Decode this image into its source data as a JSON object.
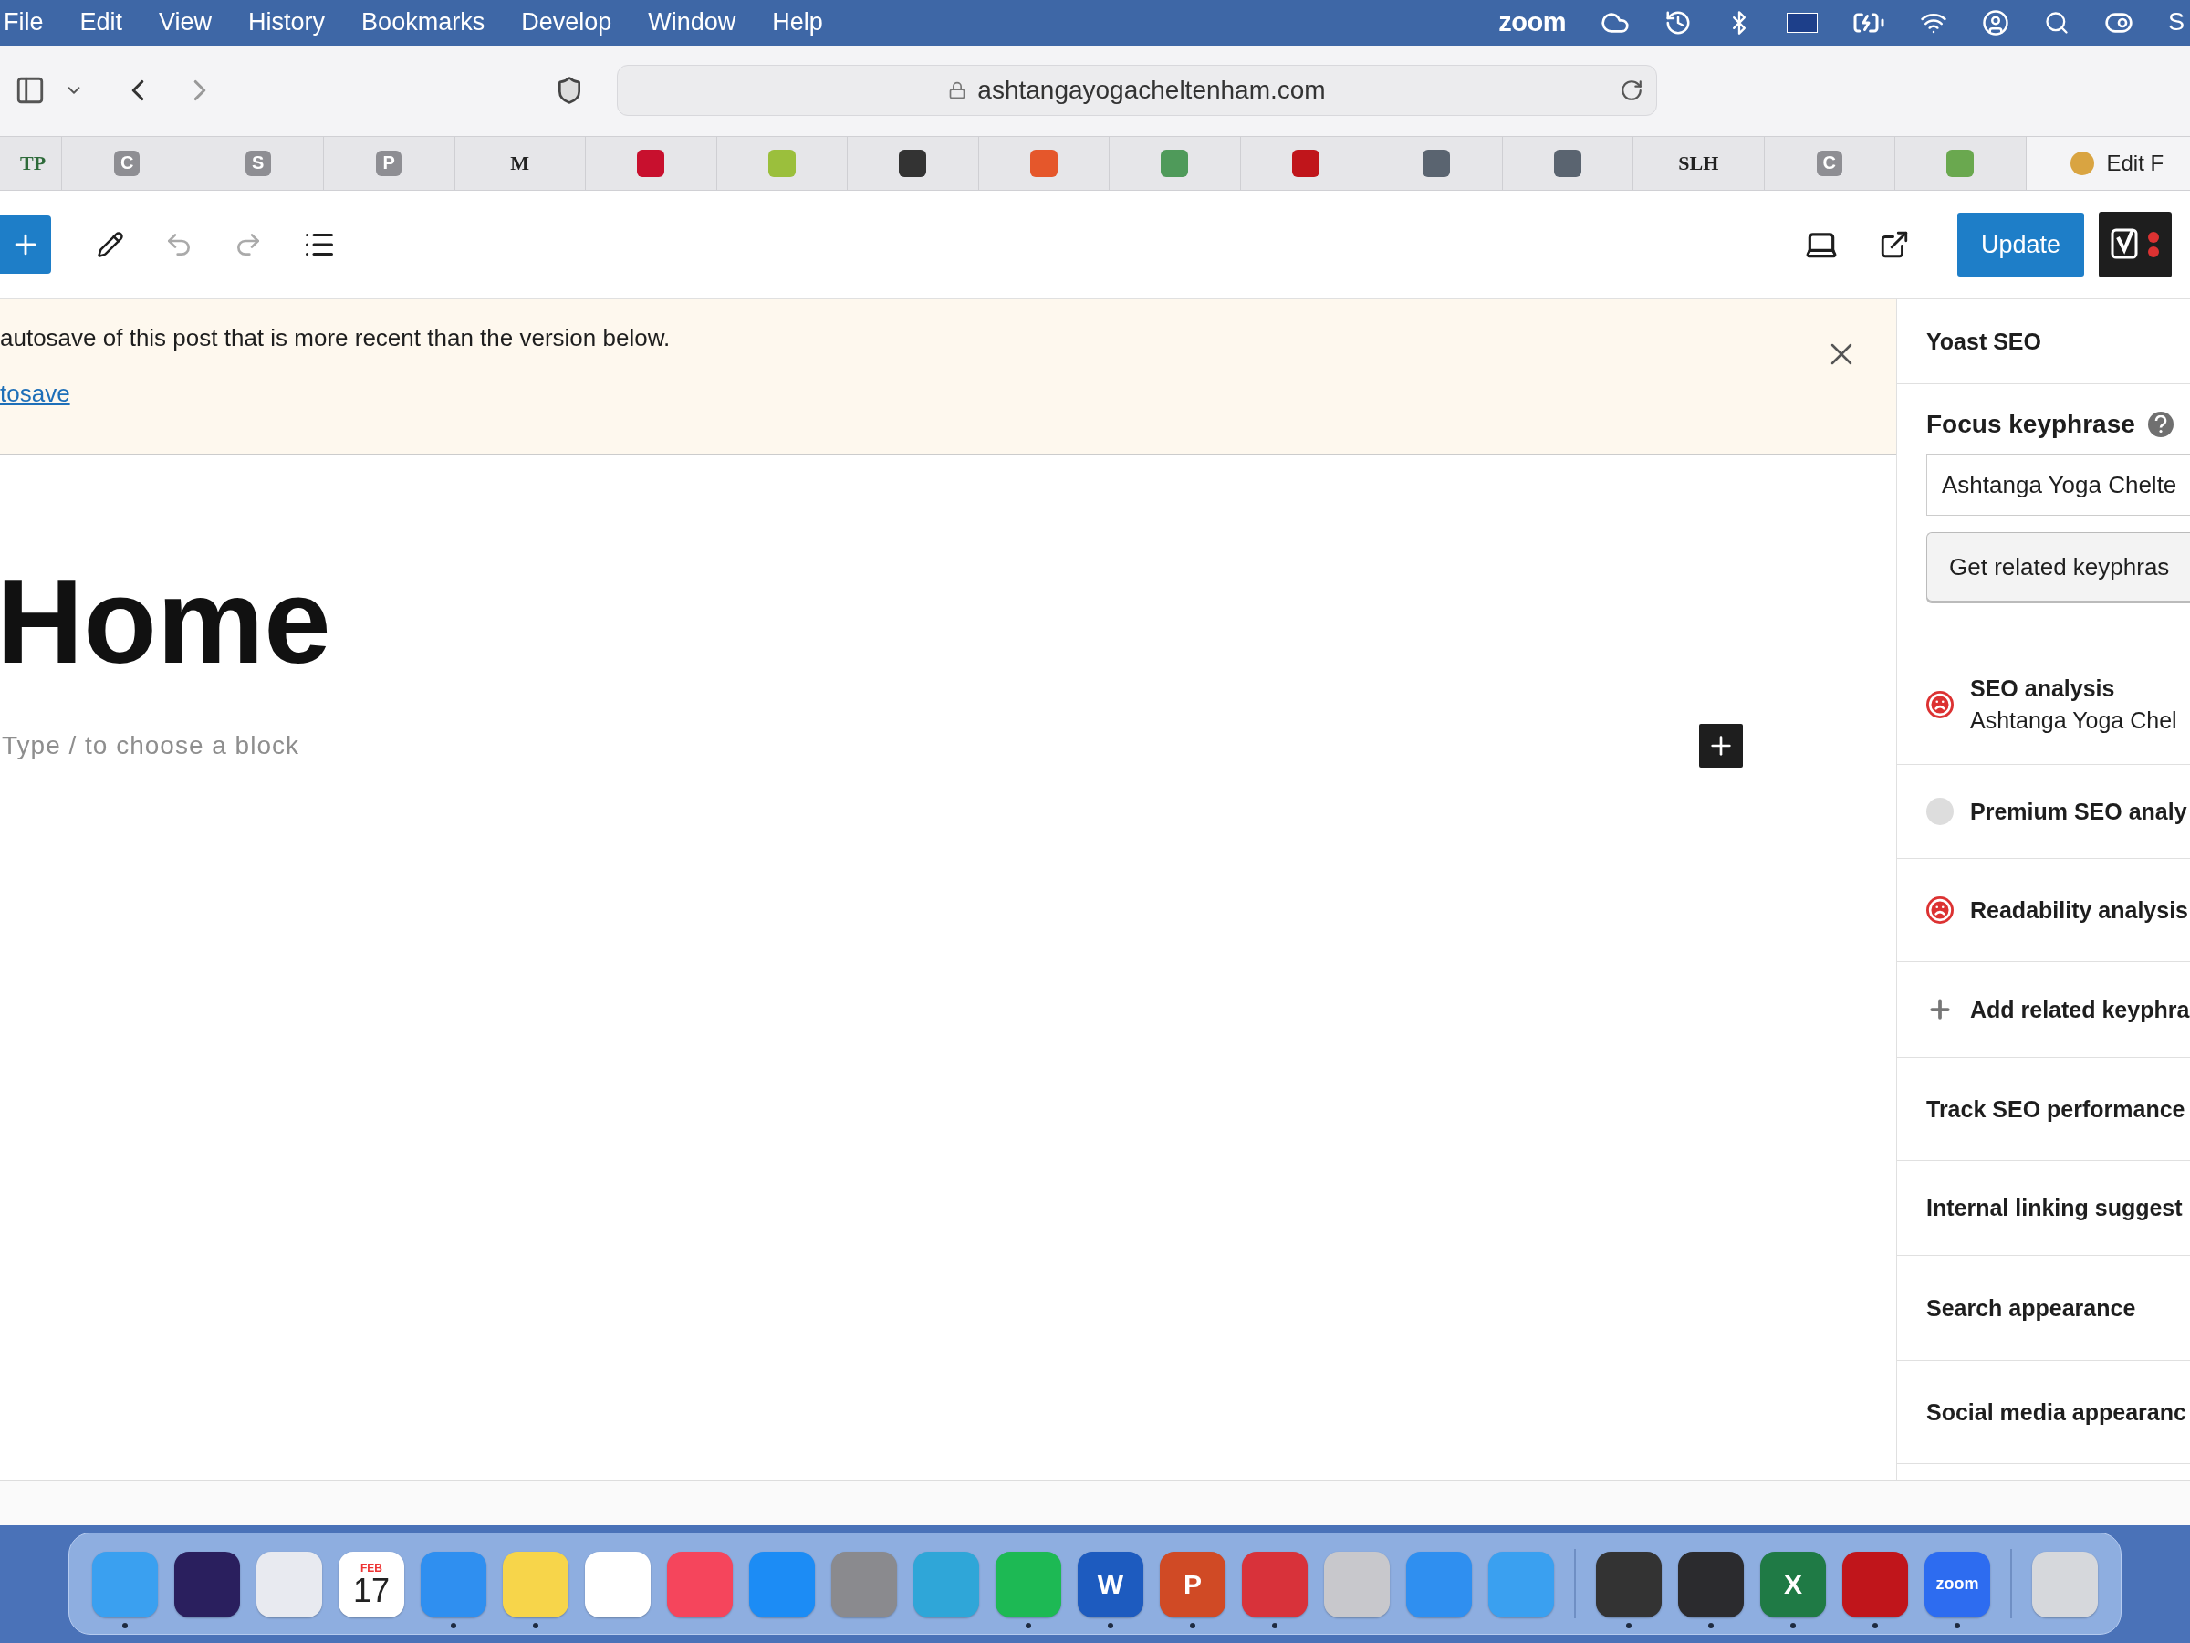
{
  "menu_bar": {
    "items": [
      "File",
      "Edit",
      "View",
      "History",
      "Bookmarks",
      "Develop",
      "Window",
      "Help"
    ],
    "zoom_label": "zoom",
    "trailing": "S"
  },
  "browser": {
    "url": "ashtangayogacheltenham.com"
  },
  "bookmarks": [
    {
      "label": "TP",
      "color": "#2e6b3a",
      "kind": "text"
    },
    {
      "label": "C",
      "color": "#8e8e93",
      "kind": "badge"
    },
    {
      "label": "S",
      "color": "#8e8e93",
      "kind": "badge"
    },
    {
      "label": "P",
      "color": "#8e8e93",
      "kind": "badge"
    },
    {
      "label": "M",
      "color": "#222222",
      "kind": "text"
    },
    {
      "color": "#c8102e",
      "kind": "icon"
    },
    {
      "color": "#9bbf3c",
      "kind": "icon"
    },
    {
      "color": "#333333",
      "kind": "icon"
    },
    {
      "color": "#e5572b",
      "kind": "icon"
    },
    {
      "color": "#4f9a5a",
      "kind": "icon"
    },
    {
      "color": "#c0151b",
      "kind": "icon"
    },
    {
      "color": "#5a6470",
      "kind": "icon"
    },
    {
      "color": "#5a6470",
      "kind": "icon"
    },
    {
      "label": "SLH",
      "color": "#222222",
      "kind": "text"
    },
    {
      "label": "C",
      "color": "#8e8e93",
      "kind": "badge"
    },
    {
      "color": "#6aa84f",
      "kind": "icon"
    },
    {
      "label": "Edit F",
      "color": "#d9a441",
      "kind": "folder"
    }
  ],
  "editor_toolbar": {
    "update_label": "Update"
  },
  "notice": {
    "text": "autosave of this post that is more recent than the version below.",
    "link": "tosave"
  },
  "post": {
    "title": "Home",
    "placeholder": "Type / to choose a block"
  },
  "sidebar": {
    "title": "Yoast SEO",
    "focus_keyphrase": {
      "label": "Focus keyphrase",
      "value": "Ashtanga Yoga Chelte",
      "button": "Get related keyphras"
    },
    "analyses": [
      {
        "title": "SEO analysis",
        "subtitle": "Ashtanga Yoga Chel",
        "problem": true
      },
      {
        "title": "Premium SEO analy",
        "problem": false
      },
      {
        "title": "Readability analysis",
        "problem": true
      }
    ],
    "add_label": "Add related keyphra",
    "sections": [
      "Track SEO performance",
      "Internal linking suggest",
      "Search appearance",
      "Social media appearanc"
    ]
  },
  "dock": [
    {
      "color": "#3aa0f0",
      "running": true
    },
    {
      "color": "#2a1f5e",
      "running": false
    },
    {
      "color": "#e8eaf0",
      "running": false
    },
    {
      "color": "#ffffff",
      "running": false,
      "kind": "calendar",
      "month": "FEB",
      "day": "17"
    },
    {
      "color": "#2f8ff0",
      "running": true
    },
    {
      "color": "#f7d54a",
      "running": true
    },
    {
      "color": "#ffffff",
      "running": false
    },
    {
      "color": "#f5455c",
      "running": false
    },
    {
      "color": "#1c8cf5",
      "running": false
    },
    {
      "color": "#8a8a8e",
      "running": false
    },
    {
      "color": "#2fa6d8",
      "running": false
    },
    {
      "color": "#1db954",
      "running": true
    },
    {
      "color": "#1d5bbf",
      "running": true,
      "kind": "letter",
      "letter": "W"
    },
    {
      "color": "#d04a25",
      "running": true,
      "kind": "letter",
      "letter": "P"
    },
    {
      "color": "#d8323a",
      "running": true
    },
    {
      "color": "#c8c8cc",
      "running": false
    },
    {
      "color": "#2f8ff0",
      "running": false
    },
    {
      "color": "#3aa0f0",
      "running": false
    },
    {
      "color": "#333333",
      "running": true,
      "separator_before": true
    },
    {
      "color": "#2b2b2e",
      "running": true
    },
    {
      "color": "#1f7a45",
      "running": true,
      "kind": "letter",
      "letter": "X"
    },
    {
      "color": "#c0151b",
      "running": true
    },
    {
      "color": "#2d6cf0",
      "running": true,
      "kind": "letter",
      "letter": "zoom"
    },
    {
      "color": "#d6d8dc",
      "running": false,
      "separator_before": true
    }
  ]
}
